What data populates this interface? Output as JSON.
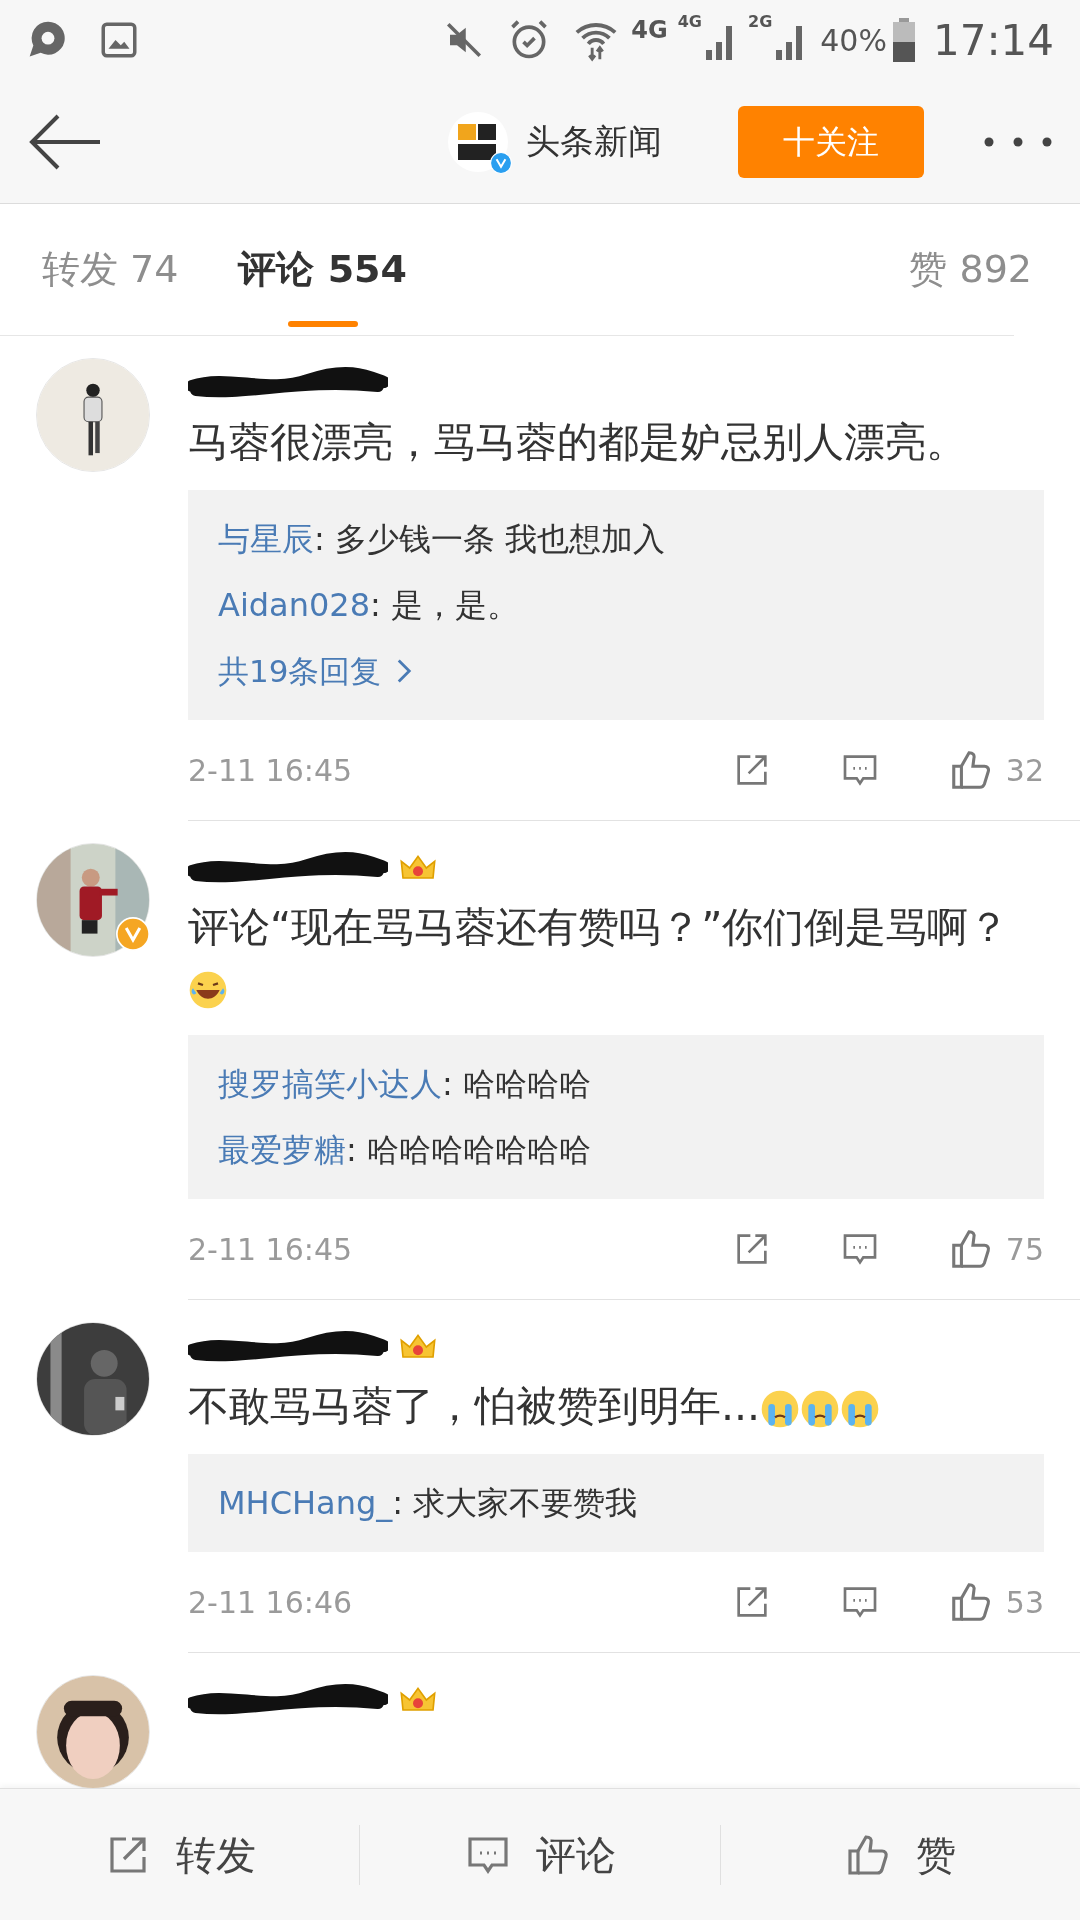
{
  "status_bar": {
    "network_labels": [
      "4G",
      "4G",
      "2G"
    ],
    "battery": "40%",
    "time": "17:14"
  },
  "header": {
    "title": "头条新闻",
    "follow_button": "十关注",
    "verified": true
  },
  "tabs": [
    {
      "label": "转发 74",
      "selected": false
    },
    {
      "label": "评论 554",
      "selected": true
    }
  ],
  "likes_tab": "赞 892",
  "comments": [
    {
      "verified": false,
      "crown": false,
      "text": "马蓉很漂亮，骂马蓉的都是妒忌别人漂亮。",
      "replies": [
        {
          "user": "与星辰",
          "text": ": 多少钱一条 我也想加入"
        },
        {
          "user": "Aidan028",
          "text": ": 是，是。"
        }
      ],
      "more_replies": "共19条回复",
      "time": "2-11 16:45",
      "likes": "32"
    },
    {
      "verified": true,
      "crown": true,
      "text": "评论“现在骂马蓉还有赞吗？”你们倒是骂啊？",
      "emojis": [
        {
          "kind": "laughing"
        }
      ],
      "replies": [
        {
          "user": "搜罗搞笑小达人",
          "text": ": 哈哈哈哈"
        },
        {
          "user": "最爱萝糖",
          "text": ": 哈哈哈哈哈哈哈"
        }
      ],
      "time": "2-11 16:45",
      "likes": "75"
    },
    {
      "verified": false,
      "crown": true,
      "text": "不敢骂马蓉了，怕被赞到明年...",
      "emojis": [
        {
          "kind": "crying"
        },
        {
          "kind": "crying"
        },
        {
          "kind": "crying"
        }
      ],
      "replies": [
        {
          "user": "MHCHang_",
          "text": ": 求大家不要赞我"
        }
      ],
      "time": "2-11 16:46",
      "likes": "53"
    },
    {
      "verified": false,
      "crown": true
    }
  ],
  "bottom_bar": [
    {
      "kind": "repost",
      "label": "转发"
    },
    {
      "kind": "comment",
      "label": "评论"
    },
    {
      "kind": "like",
      "label": "赞"
    }
  ]
}
